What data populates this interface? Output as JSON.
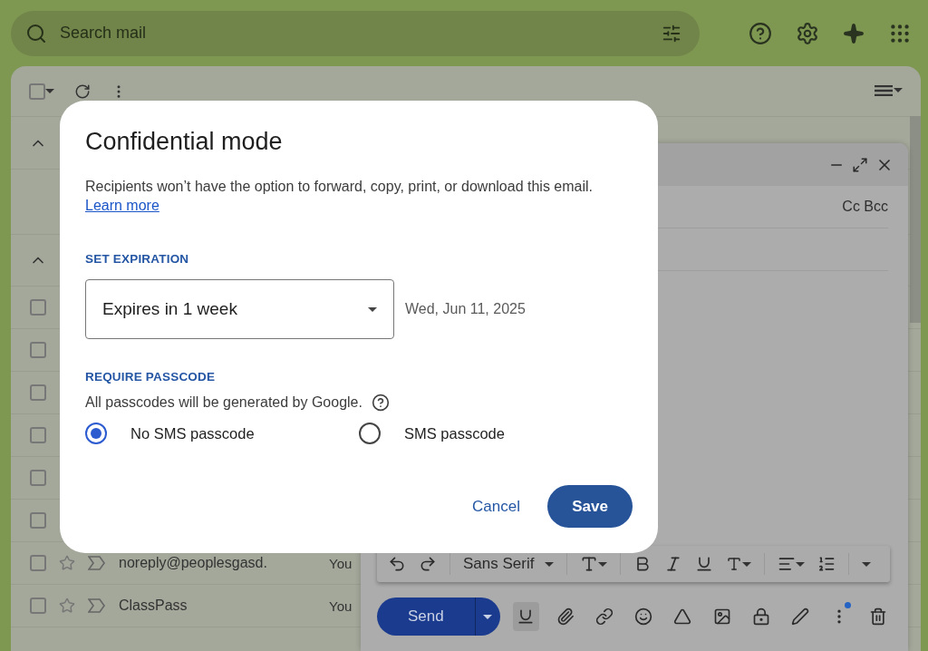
{
  "search": {
    "placeholder": "Search mail"
  },
  "mail_list": {
    "select_all_checked": false,
    "rows": [
      {
        "kind": "covered",
        "checked": false
      },
      {
        "kind": "covered",
        "checked": false
      },
      {
        "kind": "covered",
        "checked": false
      },
      {
        "kind": "covered",
        "checked": false
      },
      {
        "kind": "covered",
        "checked": false
      },
      {
        "kind": "covered",
        "checked": false
      },
      {
        "kind": "message",
        "checked": false,
        "sender": "noreply@peoplesgasd.",
        "snippet": "You"
      },
      {
        "kind": "message",
        "checked": false,
        "sender": "ClassPass",
        "snippet": "You"
      }
    ]
  },
  "compose": {
    "recipient_actions": "Cc Bcc",
    "font": "Sans Serif",
    "send": "Send",
    "formatting_on": true,
    "more_options_badge": true
  },
  "dialog": {
    "title": "Confidential mode",
    "description": "Recipients won’t have the option to forward, copy, print, or download this email.",
    "link": "Learn more",
    "expiration": {
      "label": "SET EXPIRATION",
      "value": "Expires in 1 week",
      "date": "Wed, Jun 11, 2025"
    },
    "passcode": {
      "label": "REQUIRE PASSCODE",
      "note": "All passcodes will be generated by Google.",
      "options": [
        {
          "label": "No SMS passcode",
          "selected": true
        },
        {
          "label": "SMS passcode",
          "selected": false
        }
      ]
    },
    "buttons": {
      "cancel": "Cancel",
      "save": "Save"
    }
  }
}
